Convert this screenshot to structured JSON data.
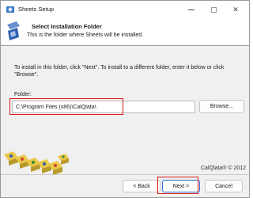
{
  "window": {
    "title": "Sheets Setup",
    "minimize_glyph": "",
    "maximize_glyph": "",
    "close_glyph": "✕"
  },
  "header": {
    "title": "Select Installation Folder",
    "subtitle": "This is the folder where Sheets will be installed."
  },
  "body": {
    "instructions": "To install in this folder, click \"Next\". To install to a different folder, enter it below or click \"Browse\".",
    "folder_label": "Folder:",
    "folder_value": "C:\\Program Files (x86)\\CalQlata\\",
    "browse_label": "Browse..."
  },
  "footer": {
    "copyright": "CalQlata® © 2012",
    "back_label": "< Back",
    "next_label": "Next >",
    "cancel_label": "Cancel"
  },
  "colors": {
    "highlight": "#e01818",
    "default_button_border": "#2a6fd6"
  },
  "icons": {
    "app": "installer-icon",
    "header": "installer-icon",
    "decoration": "letter-blocks-graphic"
  }
}
